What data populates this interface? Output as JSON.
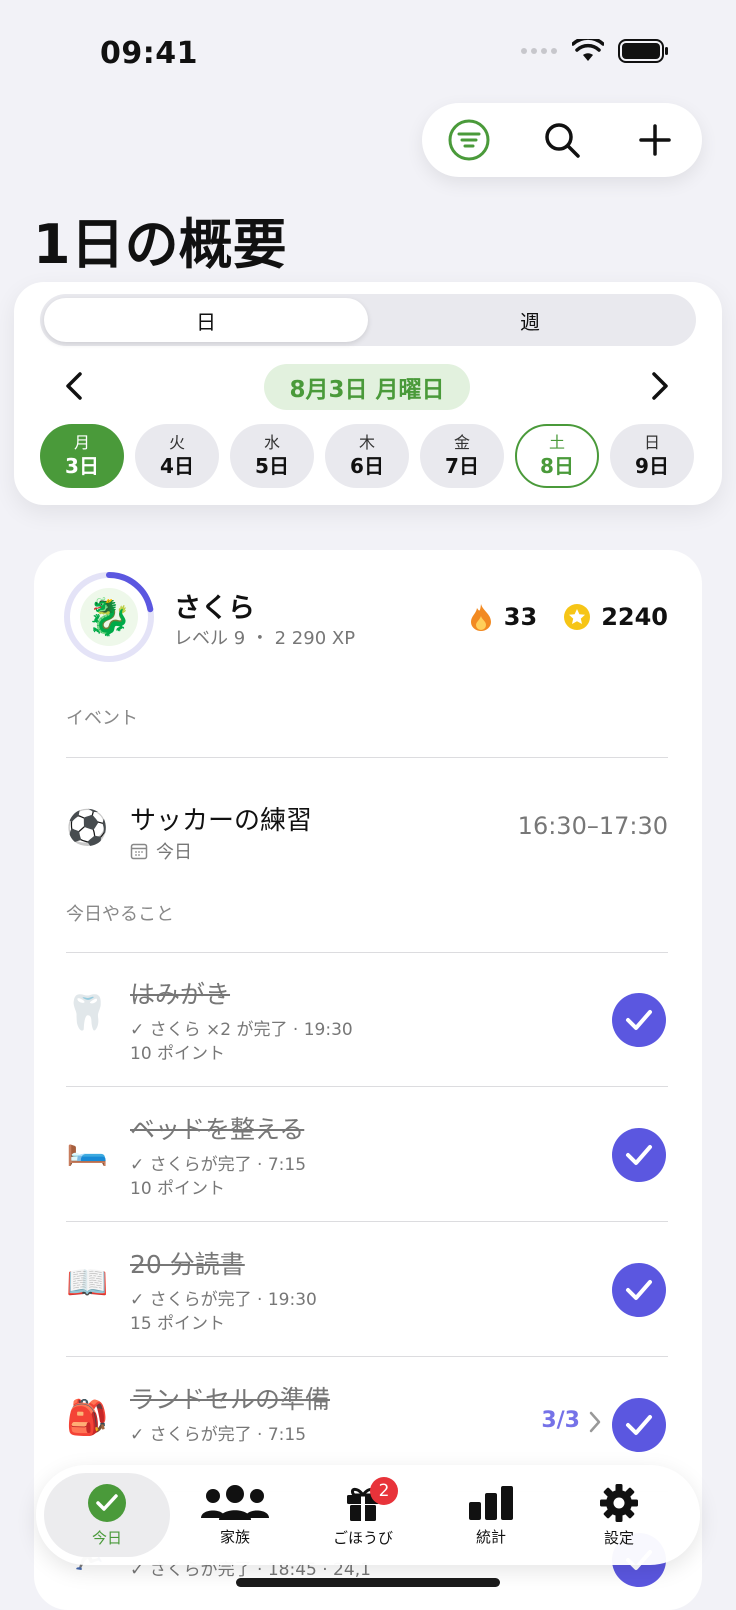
{
  "status": {
    "time": "09:41"
  },
  "page": {
    "title": "1日の概要"
  },
  "segments": {
    "day": "日",
    "week": "週"
  },
  "date_nav": {
    "current_date": "8月3日 月曜日"
  },
  "days": [
    {
      "weekday": "月",
      "date": "3日"
    },
    {
      "weekday": "火",
      "date": "4日"
    },
    {
      "weekday": "水",
      "date": "5日"
    },
    {
      "weekday": "木",
      "date": "6日"
    },
    {
      "weekday": "金",
      "date": "7日"
    },
    {
      "weekday": "土",
      "date": "8日"
    },
    {
      "weekday": "日",
      "date": "9日"
    }
  ],
  "user": {
    "name": "さくら",
    "level": "レベル 9 ・ 2 290 XP",
    "avatar_emoji": "🐉",
    "streak": "33",
    "stars": "2240",
    "level_progress": 0.22
  },
  "events_section": {
    "label": "イベント",
    "items": [
      {
        "icon": "⚽",
        "title": "サッカーの練習",
        "date": "今日",
        "time": "16:30–17:30"
      }
    ]
  },
  "todo_section": {
    "label": "今日やること",
    "items": [
      {
        "icon": "🦷",
        "title": "はみがき",
        "done": "✓ さくら ×2 が完了 · 19:30",
        "points": "10 ポイント"
      },
      {
        "icon": "🛏️",
        "title": "ベッドを整える",
        "done": "✓ さくらが完了 · 7:15",
        "points": "10 ポイント"
      },
      {
        "icon": "📖",
        "title": "20 分読書",
        "done": "✓ さくらが完了 · 19:30",
        "points": "15 ポイント"
      },
      {
        "icon": "🎒",
        "title": "ランドセルの準備",
        "done": "✓ さくらが完了 · 7:15",
        "points": "",
        "counter": "3/3"
      },
      {
        "icon": "🏃",
        "title": "",
        "done": "✓ さくらが完了 · 18:45 · 24,1",
        "points": ""
      }
    ]
  },
  "tabbar": {
    "today": "今日",
    "family": "家族",
    "rewards": "ごほうび",
    "rewards_badge": "2",
    "stats": "統計",
    "settings": "設定"
  },
  "colors": {
    "accent_green": "#4a9a3a",
    "check_purple": "#5b57e0",
    "badge_red": "#e8333a"
  }
}
